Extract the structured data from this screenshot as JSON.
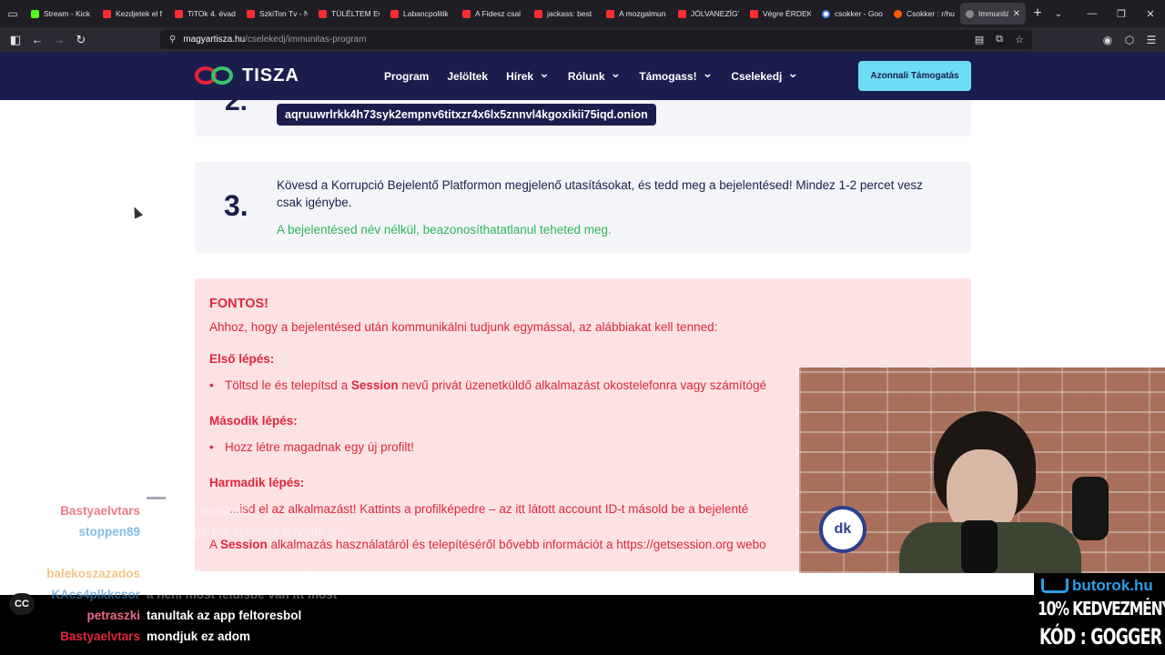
{
  "browser": {
    "tabs": [
      {
        "label": "Stream - Kick",
        "favicon": "kick"
      },
      {
        "label": "Kezdjetek el f",
        "favicon": "youtube"
      },
      {
        "label": "TiTOk 4. évad",
        "favicon": "youtube"
      },
      {
        "label": "SzkiTon Tv - N",
        "favicon": "youtube"
      },
      {
        "label": "TÚLÉLTEM EG",
        "favicon": "youtube"
      },
      {
        "label": "Labancpolitik",
        "favicon": "youtube"
      },
      {
        "label": "A Fidesz csal",
        "favicon": "youtube"
      },
      {
        "label": "jackass: best",
        "favicon": "youtube"
      },
      {
        "label": "A mozgalmun",
        "favicon": "youtube"
      },
      {
        "label": "JÓLVANEZÍGY",
        "favicon": "youtube"
      },
      {
        "label": "Végre ÉRDEKE",
        "favicon": "youtube"
      },
      {
        "label": "csokker - Goo",
        "favicon": "google"
      },
      {
        "label": "Csokker : r/hu",
        "favicon": "reddit"
      },
      {
        "label": "Immunitás",
        "favicon": "tisza",
        "active": true
      }
    ],
    "url_host": "magyartisza.hu",
    "url_path": "/cselekedj/immunitas-program"
  },
  "site": {
    "logo_text": "TISZA",
    "menu": [
      {
        "label": "Program",
        "has_dropdown": false
      },
      {
        "label": "Jelöltek",
        "has_dropdown": false
      },
      {
        "label": "Hírek",
        "has_dropdown": true
      },
      {
        "label": "Rólunk",
        "has_dropdown": true
      },
      {
        "label": "Támogass!",
        "has_dropdown": true
      },
      {
        "label": "Cselekedj",
        "has_dropdown": true
      }
    ],
    "cta_label": "Azonnali Támogatás",
    "colors": {
      "navy": "#1b1e4d",
      "red": "#e0273d",
      "green": "#2fb35d",
      "cyan": "#6fdcf5"
    }
  },
  "steps": {
    "step2": {
      "number": "2.",
      "onion": "aqruuwrlrkk4h73syk2empnv6titxzr4x6lx5znnvl4kgoxikii75iqd.onion"
    },
    "step3": {
      "number": "3.",
      "text": "Kövesd a Korrupció Bejelentő Platformon megjelenő utasításokat, és tedd meg a bejelentésed! Mindez 1-2 percet vesz csak igénybe.",
      "note": "A bejelentésed név nélkül, beazonosíthatatlanul teheted meg."
    }
  },
  "important": {
    "title": "FONTOS!",
    "intro": "Ahhoz, hogy a bejelentésed után kommunikálni tudjunk egymással, az alábbiakat kell tenned:",
    "first_heading": "Első lépés:",
    "first_pre": "Töltsd le és telepítsd a ",
    "first_bold": "Session",
    "first_post": " nevű privát üzenetküldő alkalmazást okostelefonra vagy számítógé",
    "second_heading": "Második lépés:",
    "second_item": "Hozz létre magadnak egy új profilt!",
    "third_heading": "Harmadik lépés:",
    "third_item": "...isd el az alkalmazást! Kattints a profilképedre – az itt látott account ID-t másold be a bejelenté",
    "session_pre": "A ",
    "session_bold": "Session",
    "session_post": " alkalmazás használatáról és telepítéséről bővebb információt a https://getsession.org webo"
  },
  "chat": [
    {
      "user": "Bastyaelvtars",
      "color": "#e0273d",
      "msg": "végtelen munkaiD",
      "faded": true
    },
    {
      "user": "stoppen89",
      "color": "#3a8fd6",
      "msg": "nézzél egy kis szakács istvánt. ott",
      "faded": true
    },
    {
      "user": "",
      "color": "#ffffff",
      "msg": "az ávó",
      "faded": true
    },
    {
      "user": "balekoszazados",
      "color": "#e8a13c",
      "msg": "el a kezekkel a korrupciótól!",
      "faded": true
    },
    {
      "user": "KAcs4plkkcsor",
      "color": "#3a8fd6",
      "msg": "a néni most felülsbe van itt most",
      "faded": true
    },
    {
      "user": "petraszki",
      "color": "#e86c86",
      "msg": "tanultak az app feltoresbol",
      "faded": false
    },
    {
      "user": "Bastyaelvtars",
      "color": "#e0273d",
      "msg": "mondjuk ez adom",
      "faded": false
    }
  ],
  "cc_label": "CC",
  "webcam": {
    "badge": "dk"
  },
  "sponsor": {
    "logo": "butorok.hu",
    "line1": "10% KEDVEZMÉNY",
    "line2": "KÓD : GOGGER"
  }
}
